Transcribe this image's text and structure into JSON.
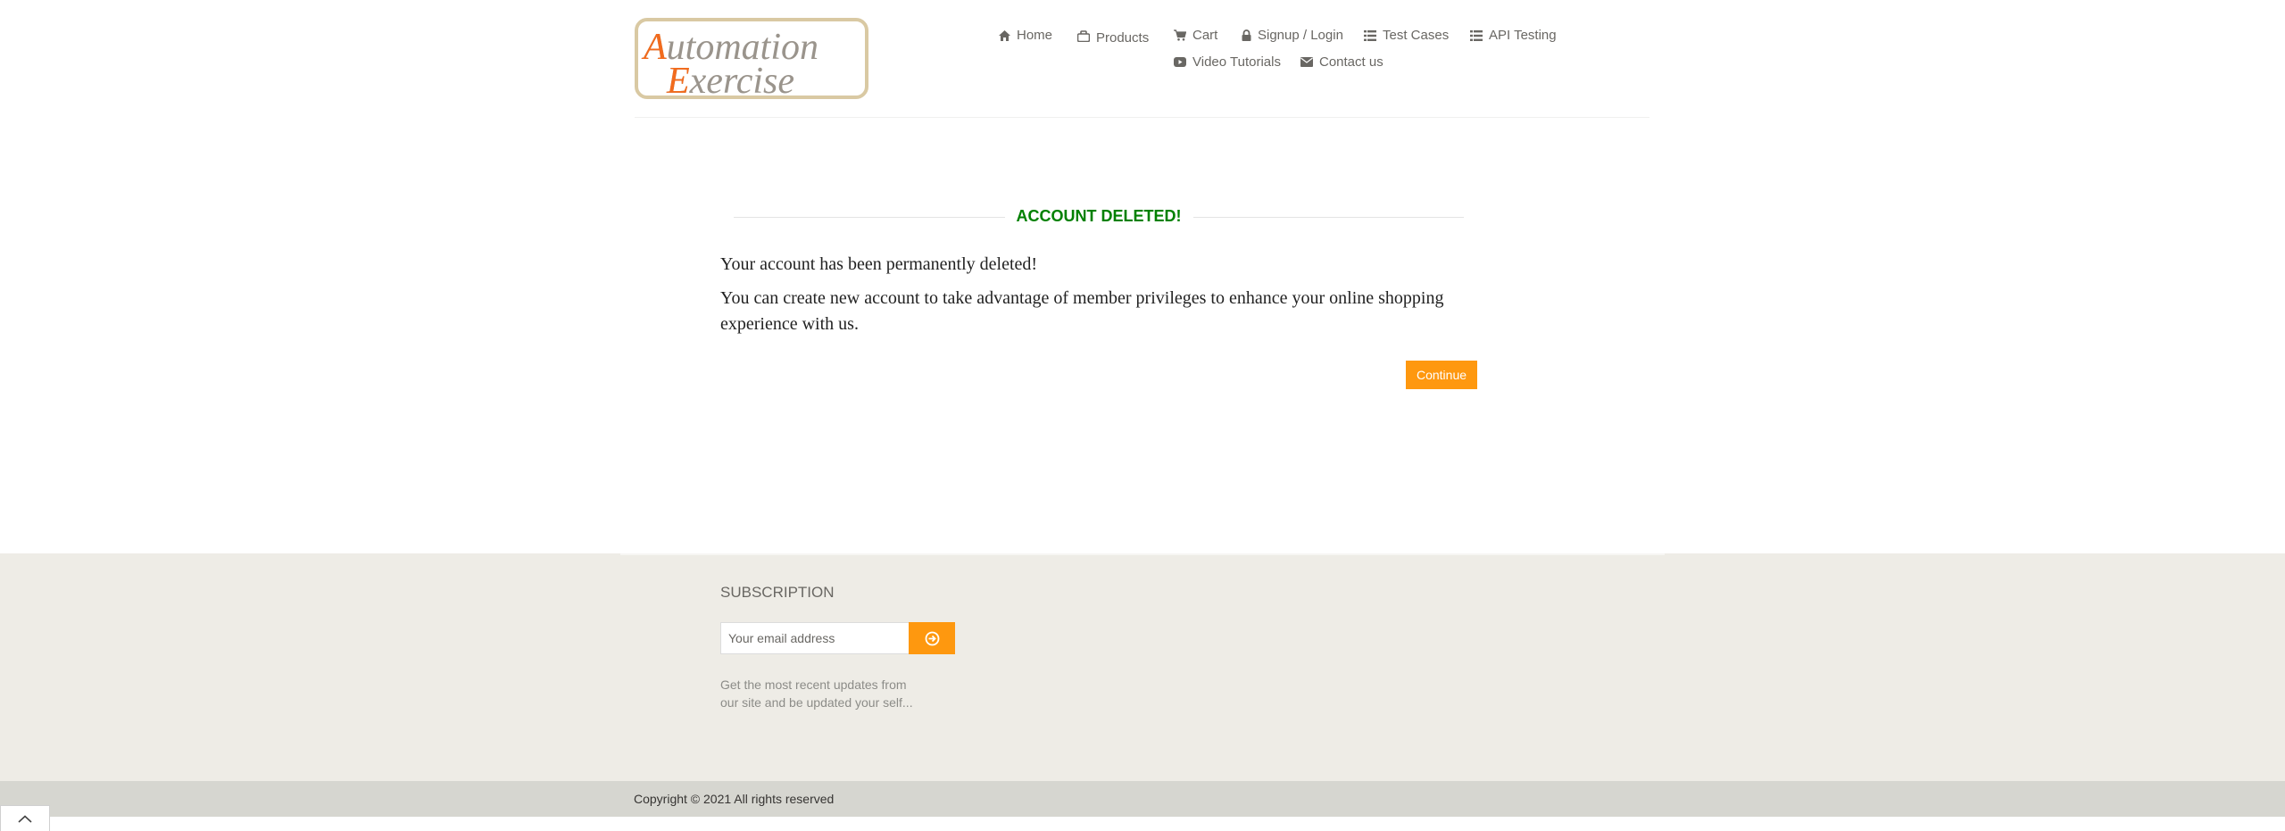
{
  "header": {
    "logo": {
      "line1": "Automation",
      "line2": "Exercise"
    },
    "nav": [
      {
        "label": "Home",
        "icon": "home-icon"
      },
      {
        "label": "Products",
        "icon": "shopping-bag-icon"
      },
      {
        "label": "Cart",
        "icon": "cart-icon"
      },
      {
        "label": "Signup / Login",
        "icon": "lock-icon"
      },
      {
        "label": "Test Cases",
        "icon": "list-icon"
      },
      {
        "label": "API Testing",
        "icon": "list-icon"
      },
      {
        "label": "Video Tutorials",
        "icon": "youtube-play-icon"
      },
      {
        "label": "Contact us",
        "icon": "envelope-icon"
      }
    ]
  },
  "main": {
    "title": "ACCOUNT DELETED!",
    "message1": "Your account has been permanently deleted!",
    "message2_line1": "You can create new account to take advantage of member privileges to enhance your online shopping",
    "message2_line2": "experience with us.",
    "continue_label": "Continue"
  },
  "footer": {
    "subscription_heading": "SUBSCRIPTION",
    "email_placeholder": "Your email address",
    "note_line1": "Get the most recent updates from",
    "note_line2": "our site and be updated your self...",
    "copyright": "Copyright © 2021 All rights reserved"
  },
  "colors": {
    "accent": "#FE980F",
    "title_green": "#008000",
    "logo_orange": "#F26B1D",
    "footer_bg": "#EEECE6"
  }
}
